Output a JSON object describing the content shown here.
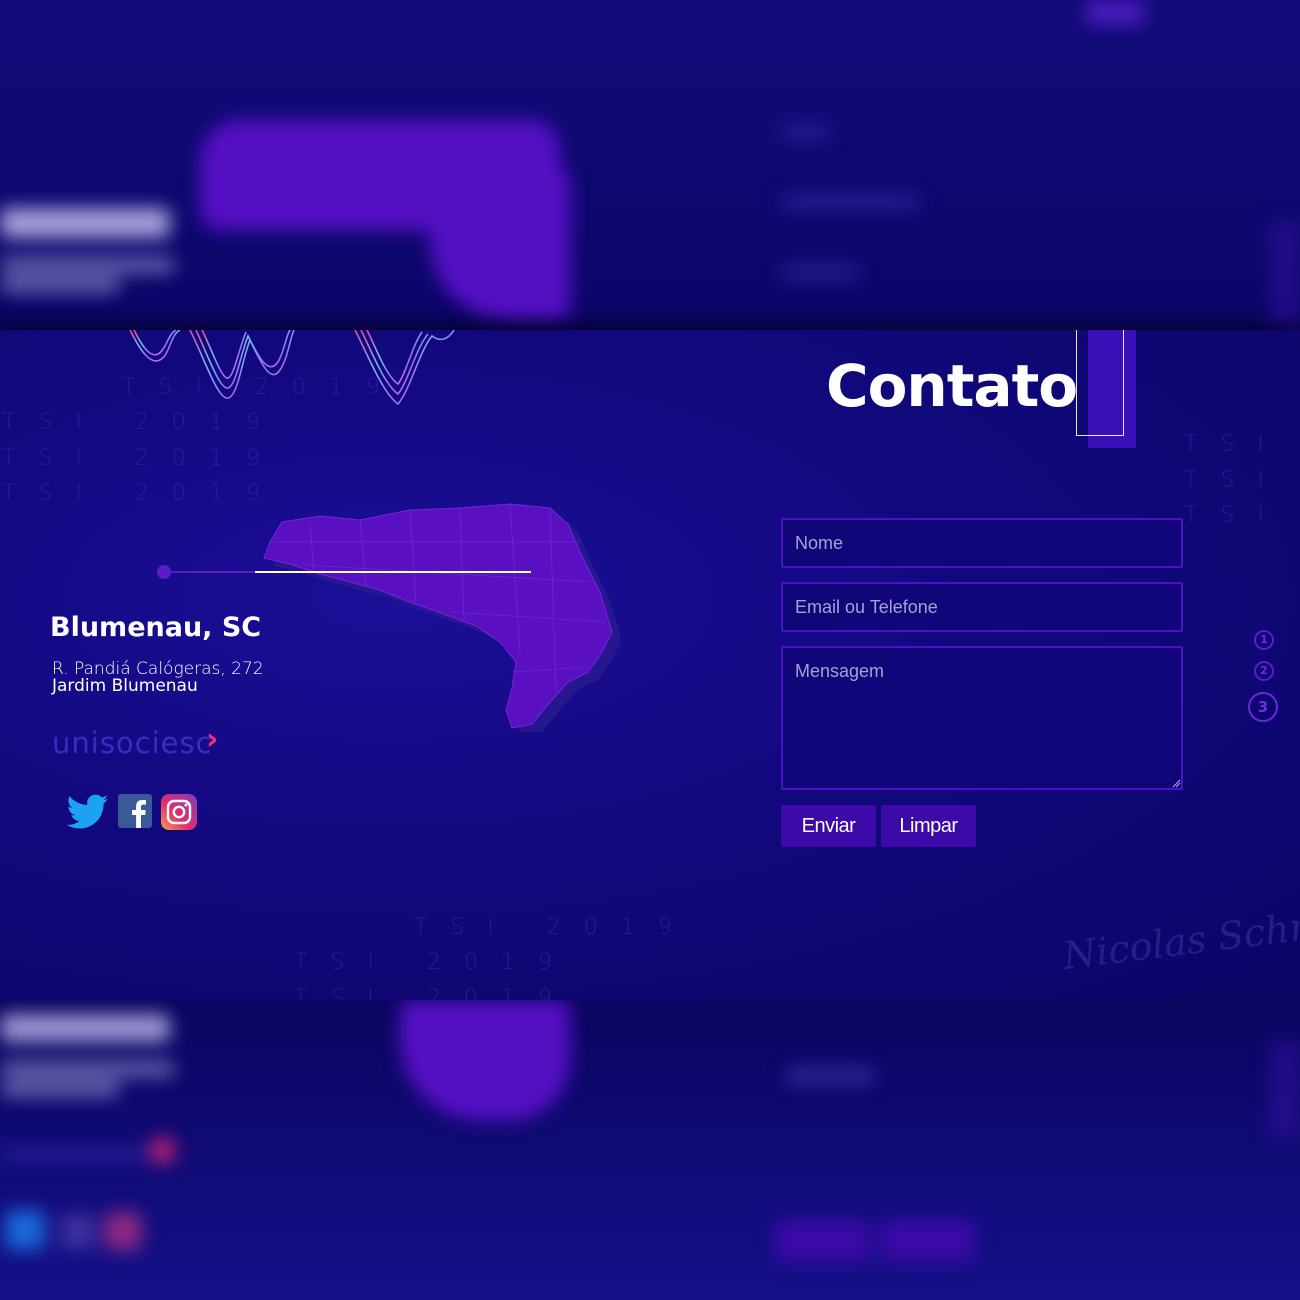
{
  "contact": {
    "title": "Contato"
  },
  "location": {
    "city": "Blumenau, SC",
    "address_line1": "R. Pandiá Calógeras, 272",
    "address_line2": "Jardim Blumenau"
  },
  "brand": {
    "name": "unisociesc",
    "chevron": "›",
    "accent_color": "#ff2a78"
  },
  "social": [
    {
      "name": "twitter",
      "icon": "twitter-icon",
      "color": "#1da1f2"
    },
    {
      "name": "facebook",
      "icon": "facebook-icon",
      "color": "#3b5998"
    },
    {
      "name": "instagram",
      "icon": "instagram-icon",
      "color": "#c13584"
    }
  ],
  "form": {
    "name_placeholder": "Nome",
    "email_placeholder": "Email ou Telefone",
    "message_placeholder": "Mensagem",
    "submit_label": "Enviar",
    "clear_label": "Limpar"
  },
  "pagination": [
    "1",
    "2",
    "3"
  ],
  "decor": {
    "grid_row_left": "TSI 2019",
    "grid_row_right": "TSI"
  },
  "signature": "Nicolas Schmidt",
  "colors": {
    "background": "#12087e",
    "accent": "#4a12c6",
    "button": "#3c0aa8",
    "map": "#5a10c0"
  }
}
